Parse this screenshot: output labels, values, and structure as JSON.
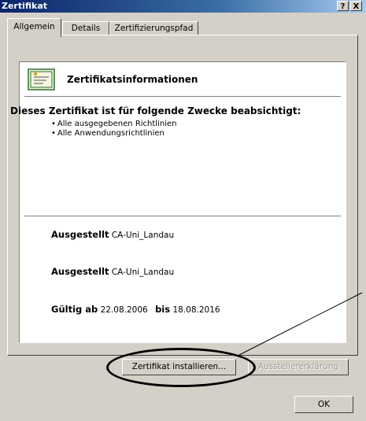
{
  "window": {
    "title": "Zertifikat",
    "help_button": "?",
    "close_button": "X"
  },
  "tabs": [
    {
      "label": "Allgemein",
      "active": true
    },
    {
      "label": "Details",
      "active": false
    },
    {
      "label": "Zertifizierungspfad",
      "active": false
    }
  ],
  "info": {
    "title": "Zertifikatsinformationen",
    "purpose_heading": "Dieses Zertifikat ist für folgende Zwecke beabsichtigt:",
    "purposes": [
      "Alle ausgegebenen Richtlinien",
      "Alle Anwendungsrichtlinien"
    ],
    "issued_to_label": "Ausgestellt",
    "issued_to_value": "CA-Uni_Landau",
    "issued_by_label": "Ausgestellt",
    "issued_by_value": "CA-Uni_Landau",
    "valid_from_label": "Gültig ab",
    "valid_from_value": "22.08.2006",
    "valid_to_label": "bis",
    "valid_to_value": "18.08.2016"
  },
  "buttons": {
    "install": "Zertifikat installieren...",
    "issuer_statement": "Ausstellererklärung",
    "ok": "OK"
  },
  "icons": {
    "certificate": "certificate-icon"
  }
}
